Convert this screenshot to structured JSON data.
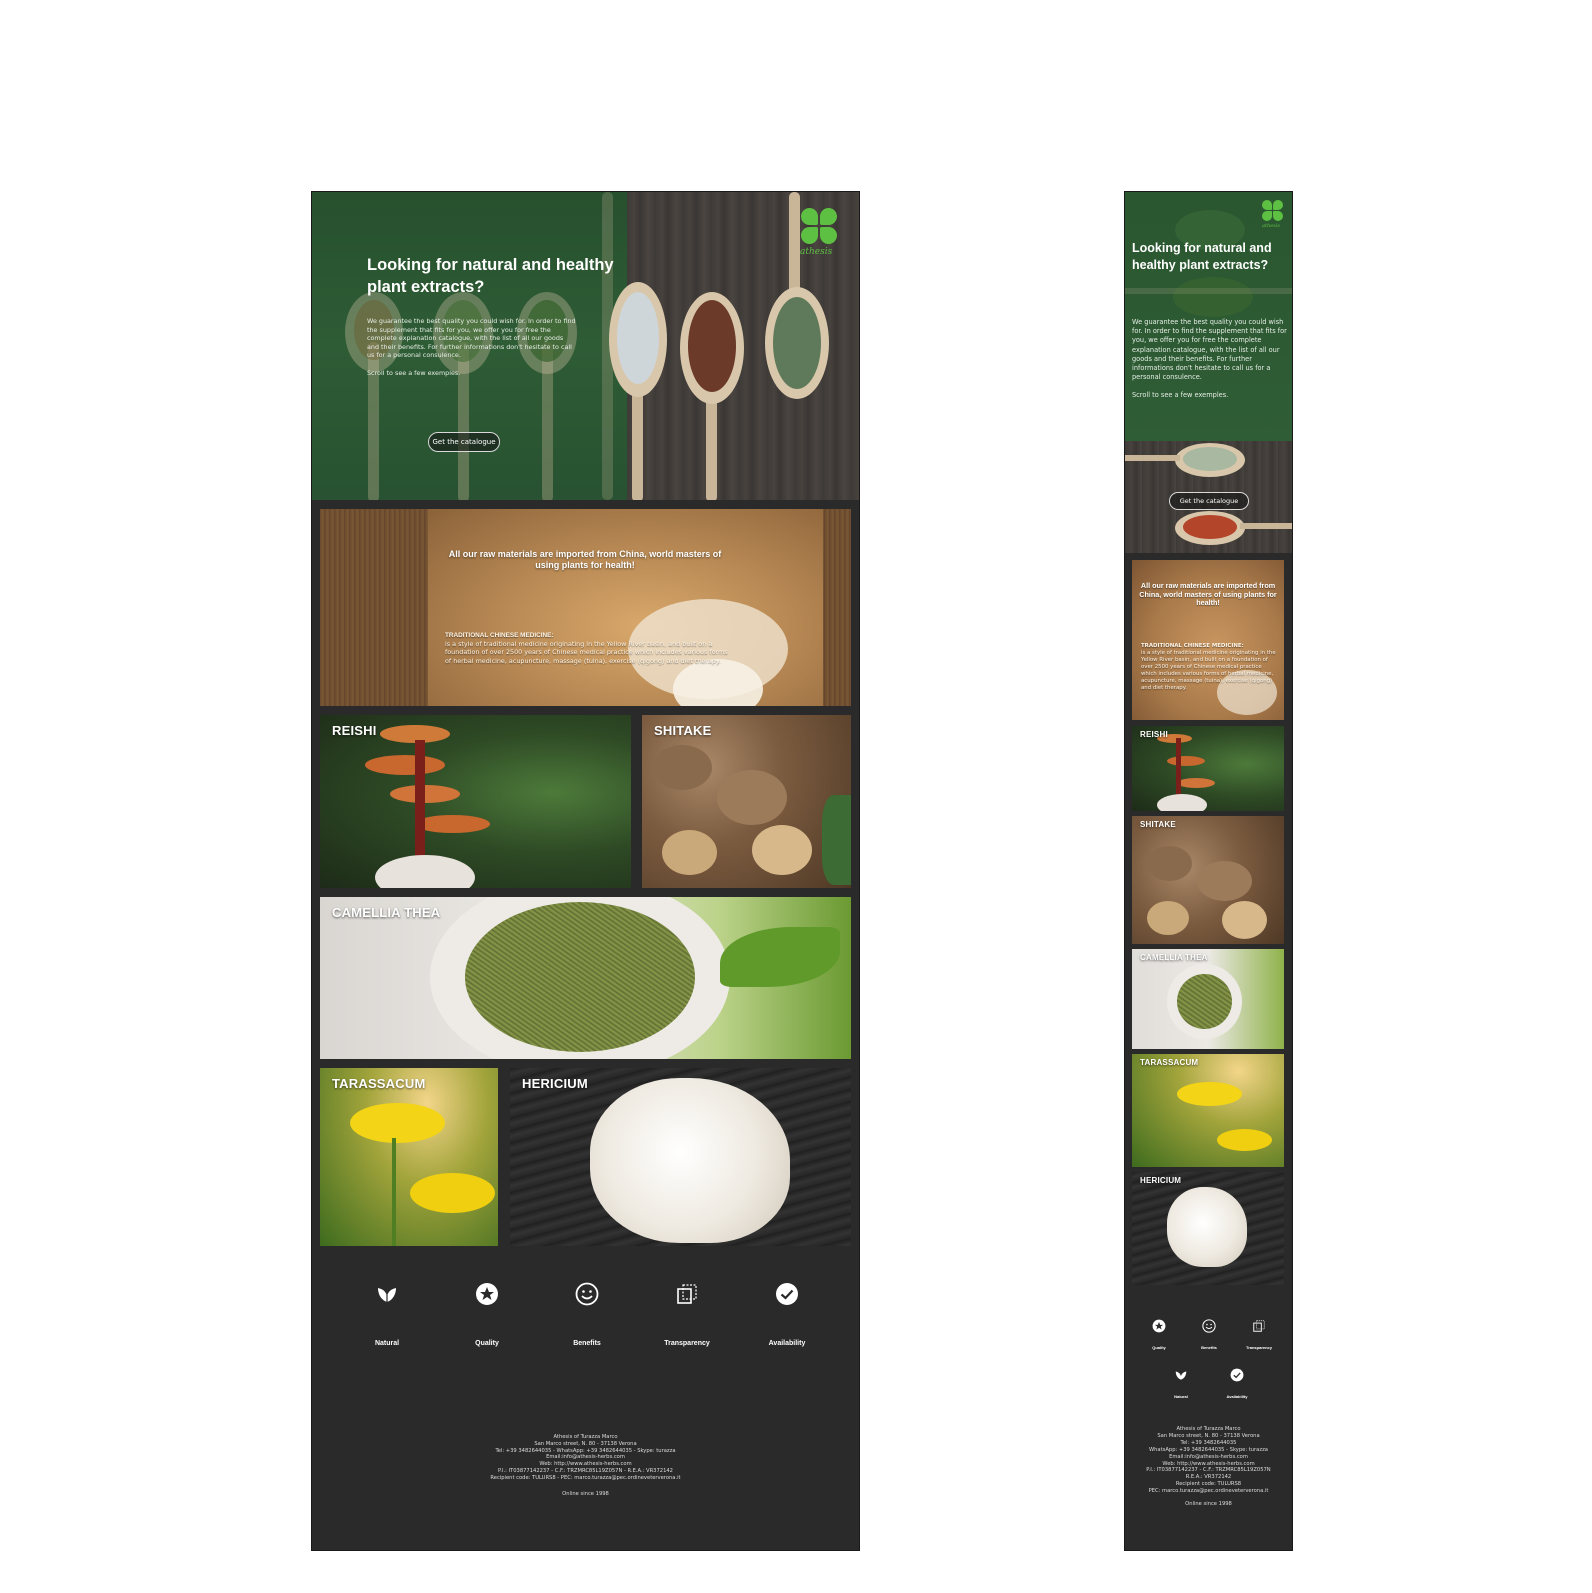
{
  "hero": {
    "title": "Looking for natural and healthy plant extracts?",
    "paragraph": "We guarantee the best quality you could wish for. In order to find the supplement that fits for you, we offer you for free the complete explanation catalogue, with the list of all our goods and their benefits. For further informations don't hesitate to call us for a personal consulence.",
    "scroll_hint": "Scroll to see a few exemples.",
    "cta_label": "Get the catalogue",
    "logo_wordmark": "athesis"
  },
  "banner": {
    "headline": "All our raw materials are imported from China, world masters of using plants for health!",
    "tcm_title": "TRADITIONAL CHINESE MEDICINE:",
    "tcm_text": "is a style of traditional medicine originating in the Yellow River basin, and built on a foundation of over 2500 years of Chinese medical practice which includes various forms of herbal medicine, acupuncture, massage (tuina), exercise (qigong) and diet therapy."
  },
  "products": [
    {
      "name": "REISHI"
    },
    {
      "name": "SHITAKE"
    },
    {
      "name": "CAMELLIA THEA"
    },
    {
      "name": "TARASSACUM"
    },
    {
      "name": "HERICIUM"
    }
  ],
  "features": [
    {
      "label": "Natural",
      "icon": "leaf-icon"
    },
    {
      "label": "Quality",
      "icon": "star-icon"
    },
    {
      "label": "Benefits",
      "icon": "smiley-icon"
    },
    {
      "label": "Transparency",
      "icon": "transparency-icon"
    },
    {
      "label": "Availability",
      "icon": "check-icon"
    }
  ],
  "footer": {
    "company": "Athesis of Turazza Marco",
    "address": "San Marco street, N. 80 - 37138 Verona",
    "contacts": "Tel: +39 3482644035 - WhatsApp: +39 3482644035 - Skype: turazza",
    "email": "Email:info@athesis-herbs.com",
    "web": "Web: http://www.athesis-herbs.com",
    "ids": "P.I.: IT03877142237 - C.F.: TRZMRC85L19Z057N - R.E.A.: VR372142",
    "recipient": "Recipient code: TULURS8 - PEC: marco.turazza@pec.ordineveterverona.it",
    "since": "Online since 1998"
  },
  "mobile_footer": {
    "company": "Athesis of Turazza Marco",
    "address": "San Marco street, N. 80 - 37138 Verona",
    "tel": "Tel: +39 3482644035",
    "whatsapp": "WhatsApp: +39 3482644035 - Skype: turazza",
    "email": "Email:info@athesis-herbs.com",
    "web": "Web: http://www.athesis-herbs.com",
    "ids": "P.I.: IT03877142237 - C.F.: TRZMRC85L19Z057N",
    "rea": "R.E.A.: VR372142",
    "recipient": "Recipient code: TULURS8",
    "pec": "PEC: marco.turazza@pec.ordineveterverona.it",
    "since": "Online since 1998"
  }
}
